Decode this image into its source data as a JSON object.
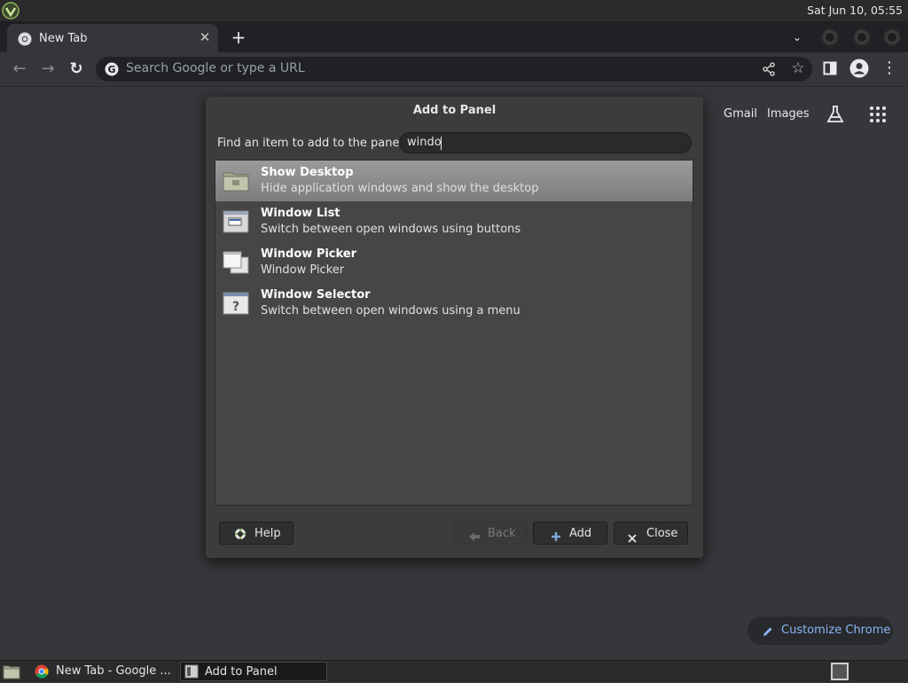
{
  "top_panel": {
    "clock": "Sat Jun 10, 05:55"
  },
  "browser": {
    "tab": {
      "title": "New Tab",
      "close_glyph": "✕"
    },
    "new_tab_glyph": "+",
    "tab_search_glyph": "⌄",
    "nav": {
      "back_glyph": "←",
      "forward_glyph": "→",
      "reload_glyph": "↻"
    },
    "omnibox": {
      "placeholder": "Search Google or type a URL"
    },
    "star_glyph": "☆",
    "menu_glyph": "⋮",
    "ntp": {
      "gmail": "Gmail",
      "images": "Images",
      "customize": "Customize Chrome"
    }
  },
  "dialog": {
    "title": "Add to Panel",
    "find_label": "Find an item to add to the panel:",
    "search_value": "windo",
    "items": [
      {
        "name": "Show Desktop",
        "description": "Hide application windows and show the desktop",
        "icon": "show-desktop-icon",
        "selected": true
      },
      {
        "name": "Window List",
        "description": "Switch between open windows using buttons",
        "icon": "window-list-icon",
        "selected": false
      },
      {
        "name": "Window Picker",
        "description": "Window Picker",
        "icon": "window-picker-icon",
        "selected": false
      },
      {
        "name": "Window Selector",
        "description": "Switch between open windows using a menu",
        "icon": "window-selector-icon",
        "selected": false
      }
    ],
    "buttons": {
      "help": "Help",
      "back": "Back",
      "add": "Add",
      "close": "Close"
    }
  },
  "taskbar": {
    "items": [
      {
        "label": "New Tab - Google ...",
        "icon": "chrome-icon",
        "active": false
      },
      {
        "label": "Add to Panel",
        "icon": "panel-icon",
        "active": true
      }
    ]
  },
  "colors": {
    "accent_link": "#8ab4f8",
    "selected_row": "#8c8c8c",
    "dialog_bg": "#3c3c3c"
  }
}
